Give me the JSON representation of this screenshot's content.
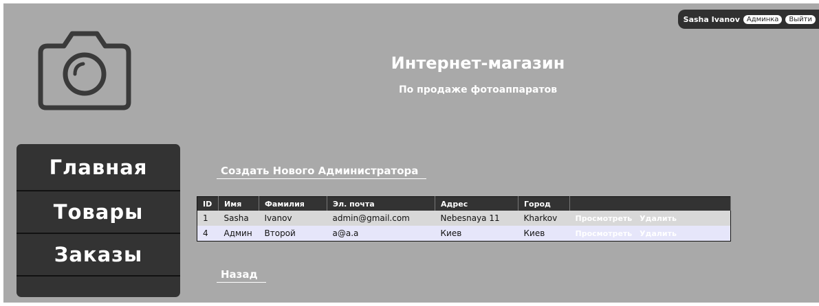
{
  "header": {
    "title": "Интернет-магазин",
    "subtitle": "По продаже фотоаппаратов"
  },
  "userbar": {
    "username": "Sasha Ivanov",
    "admin_label": "Админка",
    "logout_label": "Выйти"
  },
  "nav": {
    "items": [
      {
        "label": "Главная"
      },
      {
        "label": "Товары"
      },
      {
        "label": "Заказы"
      }
    ]
  },
  "main": {
    "create_link": "Создать Нового Администратора",
    "back_link": "Назад",
    "table": {
      "headers": [
        "ID",
        "Имя",
        "Фамилия",
        "Эл. почта",
        "Адрес",
        "Город"
      ],
      "rows": [
        {
          "id": "1",
          "first": "Sasha",
          "last": "Ivanov",
          "email": "admin@gmail.com",
          "address": "Nebesnaya 11",
          "city": "Kharkov",
          "view": "Просмотреть",
          "delete": "Удалить"
        },
        {
          "id": "4",
          "first": "Админ",
          "last": "Второй",
          "email": "a@a.a",
          "address": "Киев",
          "city": "Киев",
          "view": "Просмотреть",
          "delete": "Удалить"
        }
      ]
    }
  },
  "colors": {
    "page_bg": "#a9a9a9",
    "panel_dark": "#333333",
    "row_odd": "#d8d8d8",
    "row_even": "#e6e6fa"
  },
  "icons": {
    "logo": "camera-icon"
  }
}
